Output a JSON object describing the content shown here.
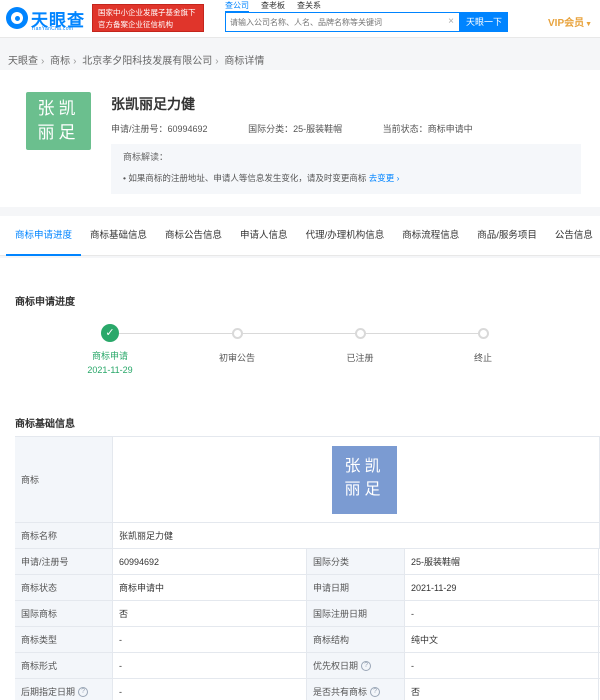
{
  "header": {
    "logo_text": "天眼查",
    "logo_sub": "TianYanCha.com",
    "banner_line1": "国家中小企业发展子基金旗下",
    "banner_line2": "官方备案企业征信机构",
    "search_tabs": [
      "查公司",
      "查老板",
      "查关系"
    ],
    "search_placeholder": "请输入公司名称、人名、品牌名称等关键词",
    "search_button": "天眼一下",
    "vip_label": "VIP会员"
  },
  "breadcrumb": [
    "天眼查",
    "商标",
    "北京孝夕阳科技发展有限公司",
    "商标详情"
  ],
  "trademark": {
    "image_line1": "张凯",
    "image_line2": "丽足",
    "name": "张凯丽足力健",
    "reg_no": "申请/注册号：60994692",
    "class": "国际分类：25-服装鞋帽",
    "status": "当前状态：商标申请中",
    "interp_title": "商标解读：",
    "interp_text": "• 如果商标的注册地址、申请人等信息发生变化，请及时变更商标",
    "interp_link": "去变更"
  },
  "tabs": [
    "商标申请进度",
    "商标基础信息",
    "商标公告信息",
    "申请人信息",
    "代理/办理机构信息",
    "商标流程信息",
    "商品/服务项目",
    "公告信息"
  ],
  "progress": {
    "title": "商标申请进度",
    "steps": [
      {
        "label": "商标申请",
        "date": "2021-11-29"
      },
      {
        "label": "初审公告"
      },
      {
        "label": "已注册"
      },
      {
        "label": "终止"
      }
    ]
  },
  "basic": {
    "title": "商标基础信息",
    "image_label": "商标",
    "rows": [
      [
        "商标名称",
        "张凯丽足力健"
      ],
      [
        "申请/注册号",
        "60994692",
        "国际分类",
        "25-服装鞋帽"
      ],
      [
        "商标状态",
        "商标申请中",
        "申请日期",
        "2021-11-29"
      ],
      [
        "国际商标",
        "否",
        "国际注册日期",
        "-"
      ],
      [
        "商标类型",
        "-",
        "商标结构",
        "纯中文"
      ],
      [
        "商标形式",
        "-",
        "优先权日期",
        "-"
      ],
      [
        "后期指定日期",
        "-",
        "是否共有商标",
        "否"
      ]
    ]
  },
  "colors": {
    "brand": "#0084ff",
    "banner": "#e0352b",
    "success": "#2aa86a",
    "vip": "#e8a33d"
  }
}
